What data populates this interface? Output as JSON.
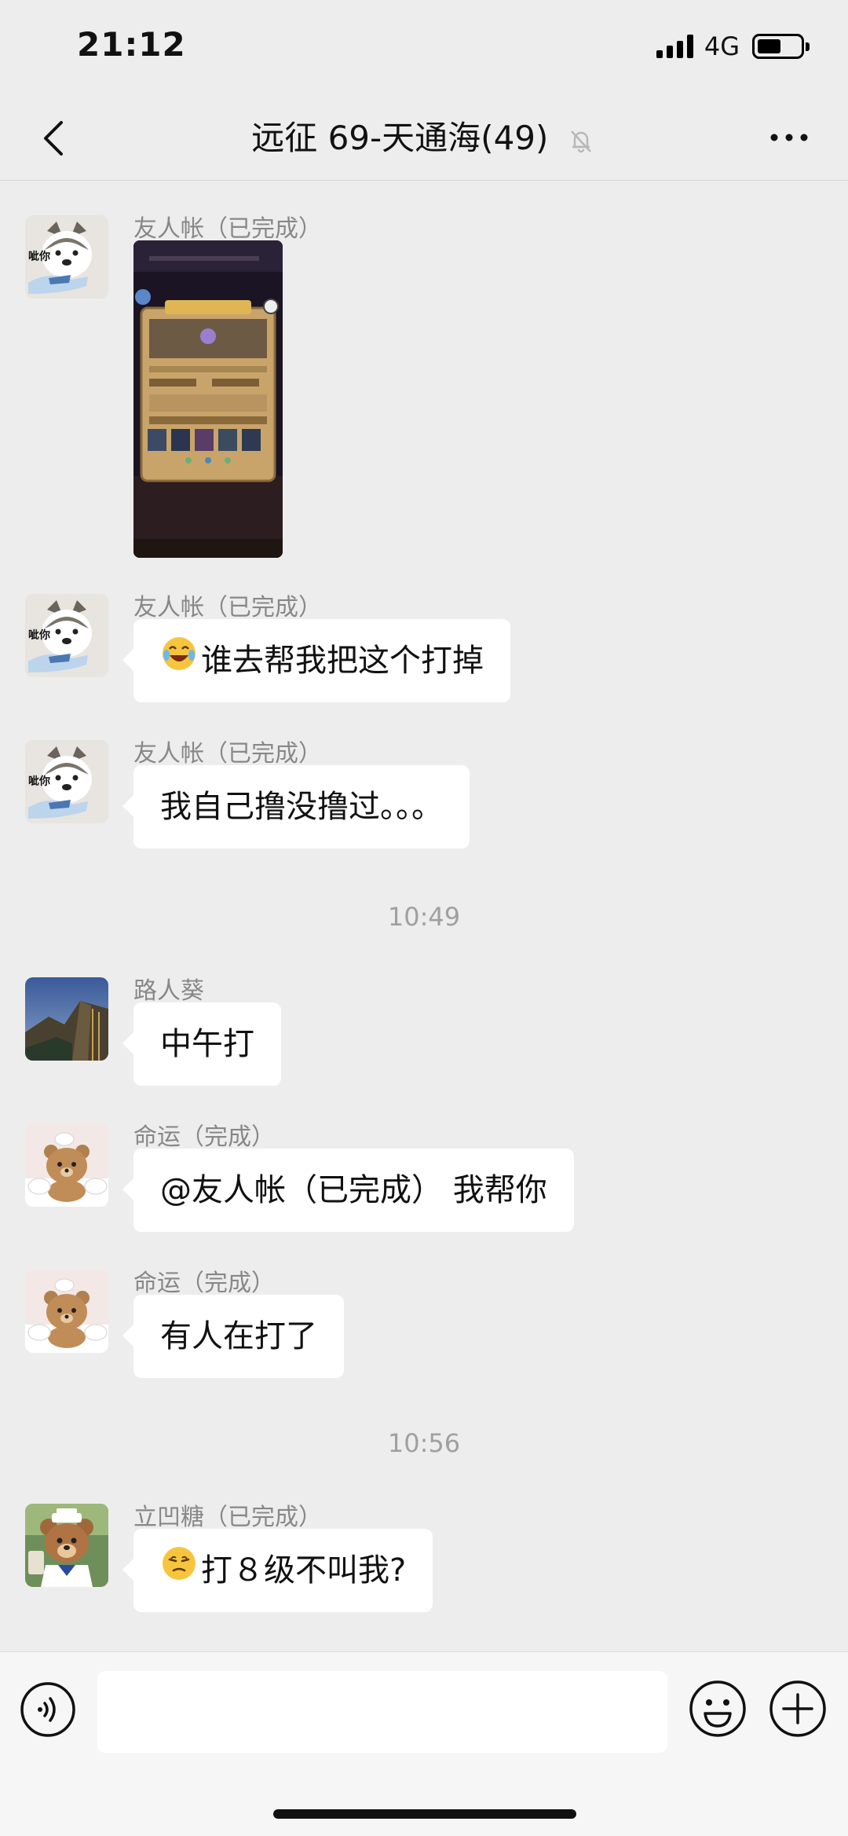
{
  "status_bar": {
    "time": "21:12",
    "network": "4G",
    "battery_level": 0.55
  },
  "nav": {
    "title": "远征 69-天通海(49)",
    "back_icon": "chevron-left-icon",
    "mute_icon": "bell-off-icon",
    "more_icon": "more-dots-icon"
  },
  "messages": [
    {
      "sender": "友人帐（已完成）",
      "type": "image",
      "image_desc": "game-screenshot"
    },
    {
      "sender": "友人帐（已完成）",
      "type": "text",
      "emoji": "😂",
      "text": "谁去帮我把这个打掉"
    },
    {
      "sender": "友人帐（已完成）",
      "type": "text",
      "text": "我自己撸没撸过。。。"
    },
    {
      "type": "time",
      "text": "10:49"
    },
    {
      "sender": "路人葵",
      "type": "text",
      "text": "中午打"
    },
    {
      "sender": "命运（完成）",
      "type": "text",
      "text": "@友人帐（已完成） 我帮你"
    },
    {
      "sender": "命运（完成）",
      "type": "text",
      "text": "有人在打了"
    },
    {
      "type": "time",
      "text": "10:56"
    },
    {
      "sender": "立凹糖（已完成）",
      "type": "text",
      "emoji": "😤",
      "text": "打８级不叫我?"
    }
  ],
  "avatar_labels": {
    "husky": "呲你"
  },
  "input_bar": {
    "placeholder": "",
    "voice_icon": "voice-icon",
    "emoji_icon": "smiley-icon",
    "plus_icon": "plus-circle-icon"
  }
}
